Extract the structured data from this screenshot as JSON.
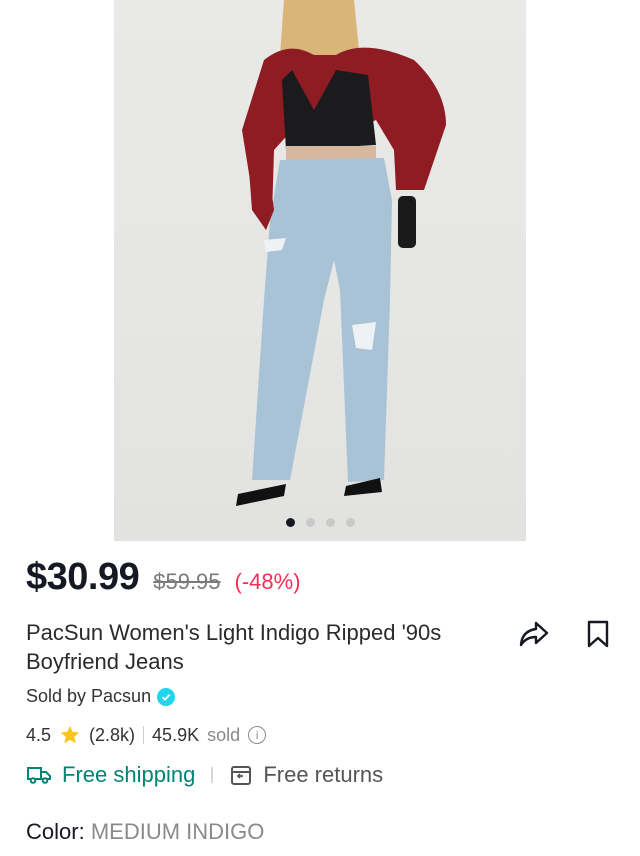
{
  "product": {
    "price": "$30.99",
    "original_price": "$59.95",
    "discount": "(-48%)",
    "title": "PacSun Women's Light Indigo Ripped '90s Boyfriend Jeans",
    "seller": "Sold by Pacsun",
    "rating": "4.5",
    "review_count": "(2.8k)",
    "sold_count": "45.9K",
    "sold_label": "sold",
    "color_label": "Color:",
    "color_value": "MEDIUM INDIGO"
  },
  "gallery": {
    "image_count": 4,
    "active_index": 0
  },
  "shipping": {
    "free_shipping": "Free shipping",
    "free_returns": "Free returns"
  },
  "icons": {
    "share": "share-arrow-icon",
    "bookmark": "bookmark-icon",
    "star": "star-icon",
    "verified": "verified-check-icon",
    "info": "info-icon",
    "truck": "truck-icon",
    "returns": "return-box-icon"
  },
  "colors": {
    "discount": "#fe2c55",
    "shipping": "#008574",
    "star": "#fcc419",
    "verified": "#20d5ec"
  }
}
